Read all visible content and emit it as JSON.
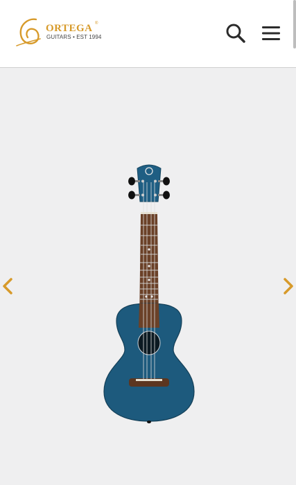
{
  "header": {
    "logo": {
      "wordmark": "ORTEGA",
      "registered": "®",
      "tagline": "GUITARS • EST 1994",
      "brand_color": "#d79a2a"
    },
    "search_icon": "search-icon",
    "menu_icon": "hamburger-menu-icon"
  },
  "gallery": {
    "prev_icon": "chevron-left-icon",
    "next_icon": "chevron-right-icon",
    "arrow_color": "#d79a2a",
    "product_image": "blue-concert-ukulele",
    "body_color": "#1d5a7d"
  }
}
